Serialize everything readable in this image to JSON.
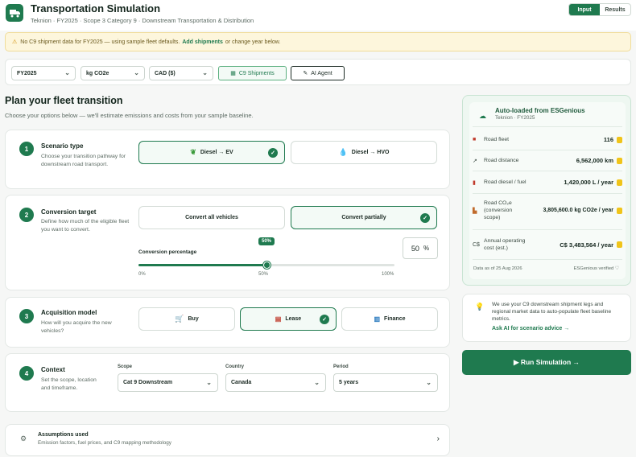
{
  "header": {
    "title": "Transportation Simulation",
    "subtitle": "Teknion · FY2025 · Scope 3 Category 9 · Downstream Transportation & Distribution",
    "tabs": [
      "Input",
      "Results"
    ]
  },
  "alert": {
    "text_before": "No C9 shipment data for FY2025 — using sample fleet defaults.",
    "link": "Add shipments",
    "text_after": "or change year below."
  },
  "filters": {
    "year": "FY2025",
    "unit": "kg CO2e",
    "currency": "CAD ($)",
    "c9_button": "C9 Shipments",
    "ai_button": "AI Agent"
  },
  "plan": {
    "heading": "Plan your fleet transition",
    "subheading": "Choose your options below — we'll estimate emissions and costs from your sample baseline."
  },
  "steps": {
    "scenario": {
      "num": "1",
      "title": "Scenario type",
      "desc": "Choose your transition pathway for downstream road transport.",
      "options": [
        "Diesel → EV",
        "Diesel → HVO"
      ]
    },
    "conversion": {
      "num": "2",
      "title": "Conversion target",
      "desc": "Define how much of the eligible fleet you want to convert.",
      "options": [
        "Convert all vehicles",
        "Convert partially"
      ],
      "slider_label": "Conversion percentage",
      "bubble": "50%",
      "value": "50",
      "value_unit": "%",
      "percent": 50,
      "ticks": [
        "0%",
        "50%",
        "100%"
      ]
    },
    "acquisition": {
      "num": "3",
      "title": "Acquisition model",
      "desc": "How will you acquire the new vehicles?",
      "options": [
        "Buy",
        "Lease",
        "Finance"
      ]
    },
    "context": {
      "num": "4",
      "title": "Context",
      "desc": "Set the scope, location and timeframe.",
      "scope_label": "Scope",
      "scope_value": "Cat 9 Downstream",
      "country_label": "Country",
      "country_value": "Canada",
      "period_label": "Period",
      "period_value": "5 years"
    }
  },
  "assumptions": {
    "title": "Assumptions used",
    "desc": "Emission factors, fuel prices, and C9 mapping methodology"
  },
  "sidebar": {
    "title": "Auto-loaded from ESGenious",
    "subtitle": "Teknion · FY2025",
    "rows": [
      {
        "label": "Road fleet",
        "value": "116"
      },
      {
        "label": "Road distance",
        "value": "6,562,000 km"
      },
      {
        "label": "Road diesel / fuel",
        "value": "1,420,000 L / year"
      },
      {
        "label": "Road CO₂e (conversion scope)",
        "value": "3,805,600.0 kg CO2e / year"
      },
      {
        "label": "Annual operating cost (est.)",
        "value": "C$ 3,483,564 / year"
      }
    ],
    "footer_left": "Data as of 25 Aug 2026",
    "footer_right": "ESGenious verified ♡"
  },
  "ai_card": {
    "text": "We use your C9 downstream shipment legs and regional market data to auto-populate fleet baseline metrics.",
    "link": "Ask AI for scenario advice →"
  },
  "run_button": "▶ Run Simulation →",
  "colors": {
    "accent": "#1f7a4f",
    "alert_bg": "#fdf6dc",
    "lock": "#f0c419"
  }
}
